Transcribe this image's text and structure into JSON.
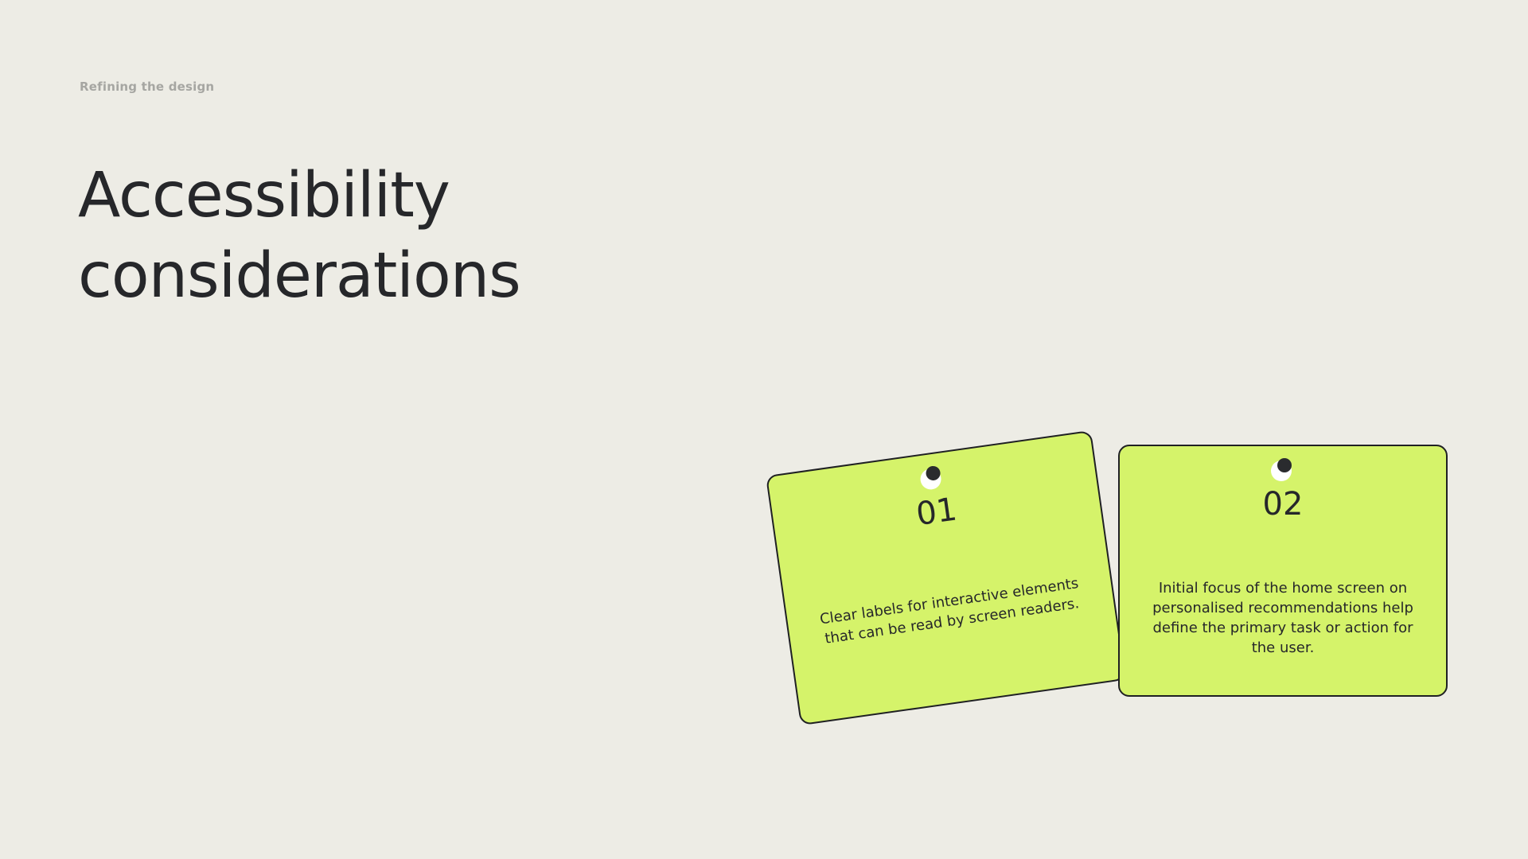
{
  "slide": {
    "section_label": "Refining the design",
    "title_line_1": "Accessibility",
    "title_line_2": "considerations"
  },
  "cards": [
    {
      "number": "01",
      "text": "Clear labels for interactive elements that can be read by screen readers."
    },
    {
      "number": "02",
      "text": "Initial focus of the home screen on personalised recommendations help define the primary task or action for the user."
    }
  ],
  "colors": {
    "background": "#EDECE5",
    "card_fill": "#D5F36A",
    "text_dark": "#26272a",
    "label_gray": "#a6a6a2"
  }
}
